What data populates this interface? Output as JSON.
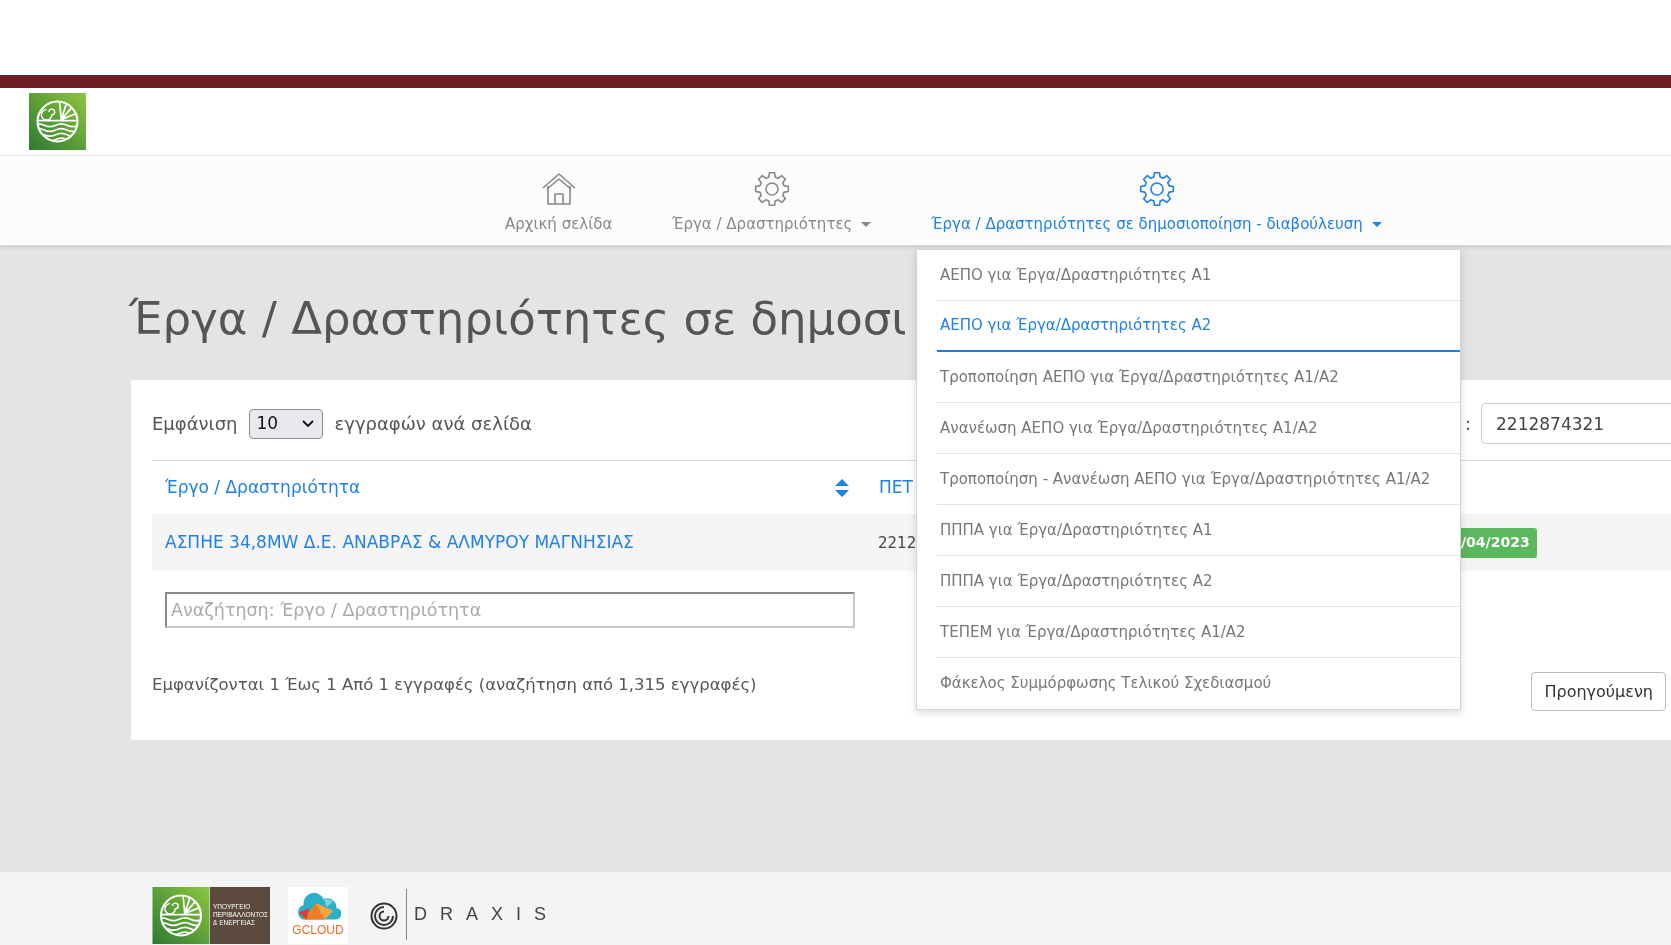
{
  "nav": {
    "items": [
      {
        "label": "Αρχική σελίδα",
        "kind": "home",
        "has_menu": false,
        "selected": false
      },
      {
        "label": "Έργα / Δραστηριότητες",
        "kind": "gear",
        "has_menu": true,
        "selected": false
      },
      {
        "label": "Έργα / Δραστηριότητες σε δημοσιοποίηση - διαβούλευση",
        "kind": "gear",
        "has_menu": true,
        "selected": true
      }
    ]
  },
  "page_title": "Έργα / Δραστηριότητες σε δημοσι",
  "dropdown": {
    "items": [
      {
        "label": "ΑΕΠΟ για Έργα/Δραστηριότητες Α1",
        "selected": false
      },
      {
        "label": "ΑΕΠΟ για Έργα/Δραστηριότητες Α2",
        "selected": true
      },
      {
        "label": "Τροποποίηση ΑΕΠΟ για Έργα/Δραστηριότητες Α1/Α2",
        "selected": false
      },
      {
        "label": "Ανανέωση ΑΕΠΟ για Έργα/Δραστηριότητες Α1/Α2",
        "selected": false
      },
      {
        "label": "Τροποποίηση - Ανανέωση ΑΕΠΟ για Έργα/Δραστηριότητες Α1/Α2",
        "selected": false
      },
      {
        "label": "ΠΠΠΑ για Έργα/Δραστηριότητες Α1",
        "selected": false
      },
      {
        "label": "ΠΠΠΑ για Έργα/Δραστηριότητες Α2",
        "selected": false
      },
      {
        "label": "ΤΕΠΕΜ για Έργα/Δραστηριότητες Α1/Α2",
        "selected": false
      },
      {
        "label": "Φάκελος Συμμόρφωσης Τελικού Σχεδιασμού",
        "selected": false
      }
    ]
  },
  "table_controls": {
    "length_label": "Εμφάνιση",
    "page_length": "10",
    "length_suffix": "εγγραφών ανά σελίδα",
    "search_label": ":",
    "search_value": "2212874321"
  },
  "table": {
    "columns": [
      {
        "label": "Έργο / Δραστηριότητα",
        "sortable": true
      },
      {
        "label": "ΠΕΤ",
        "sortable": false
      }
    ],
    "rows": [
      {
        "cells": [
          "ΑΣΠΗΕ 34,8MW Δ.Ε. ΑΝΑΒΡΑΣ & ΑΛΜΥΡΟΥ ΜΑΓΝΗΣΙΑΣ",
          "2212"
        ],
        "badge": "/04/2023"
      }
    ]
  },
  "column_filter": {
    "placeholder": "Αναζήτηση: Έργο / Δραστηριότητα"
  },
  "info": "Εμφανίζονται 1 Έως 1 Από 1 εγγραφές (αναζήτηση από 1,315 εγγραφές)",
  "pagination": {
    "buttons": [
      "Προηγούμενη"
    ]
  },
  "footer": {
    "ministry_name_lines": [
      "ΥΠΟΥΡΓΕΙΟ",
      "ΠΕΡΙΒΑΛΛΟΝΤΟΣ",
      "& ΕΝΕΡΓΕΙΑΣ"
    ],
    "gcloud_wordmark": "GCLOUD",
    "draxis_wordmark": "DRAXIS"
  }
}
